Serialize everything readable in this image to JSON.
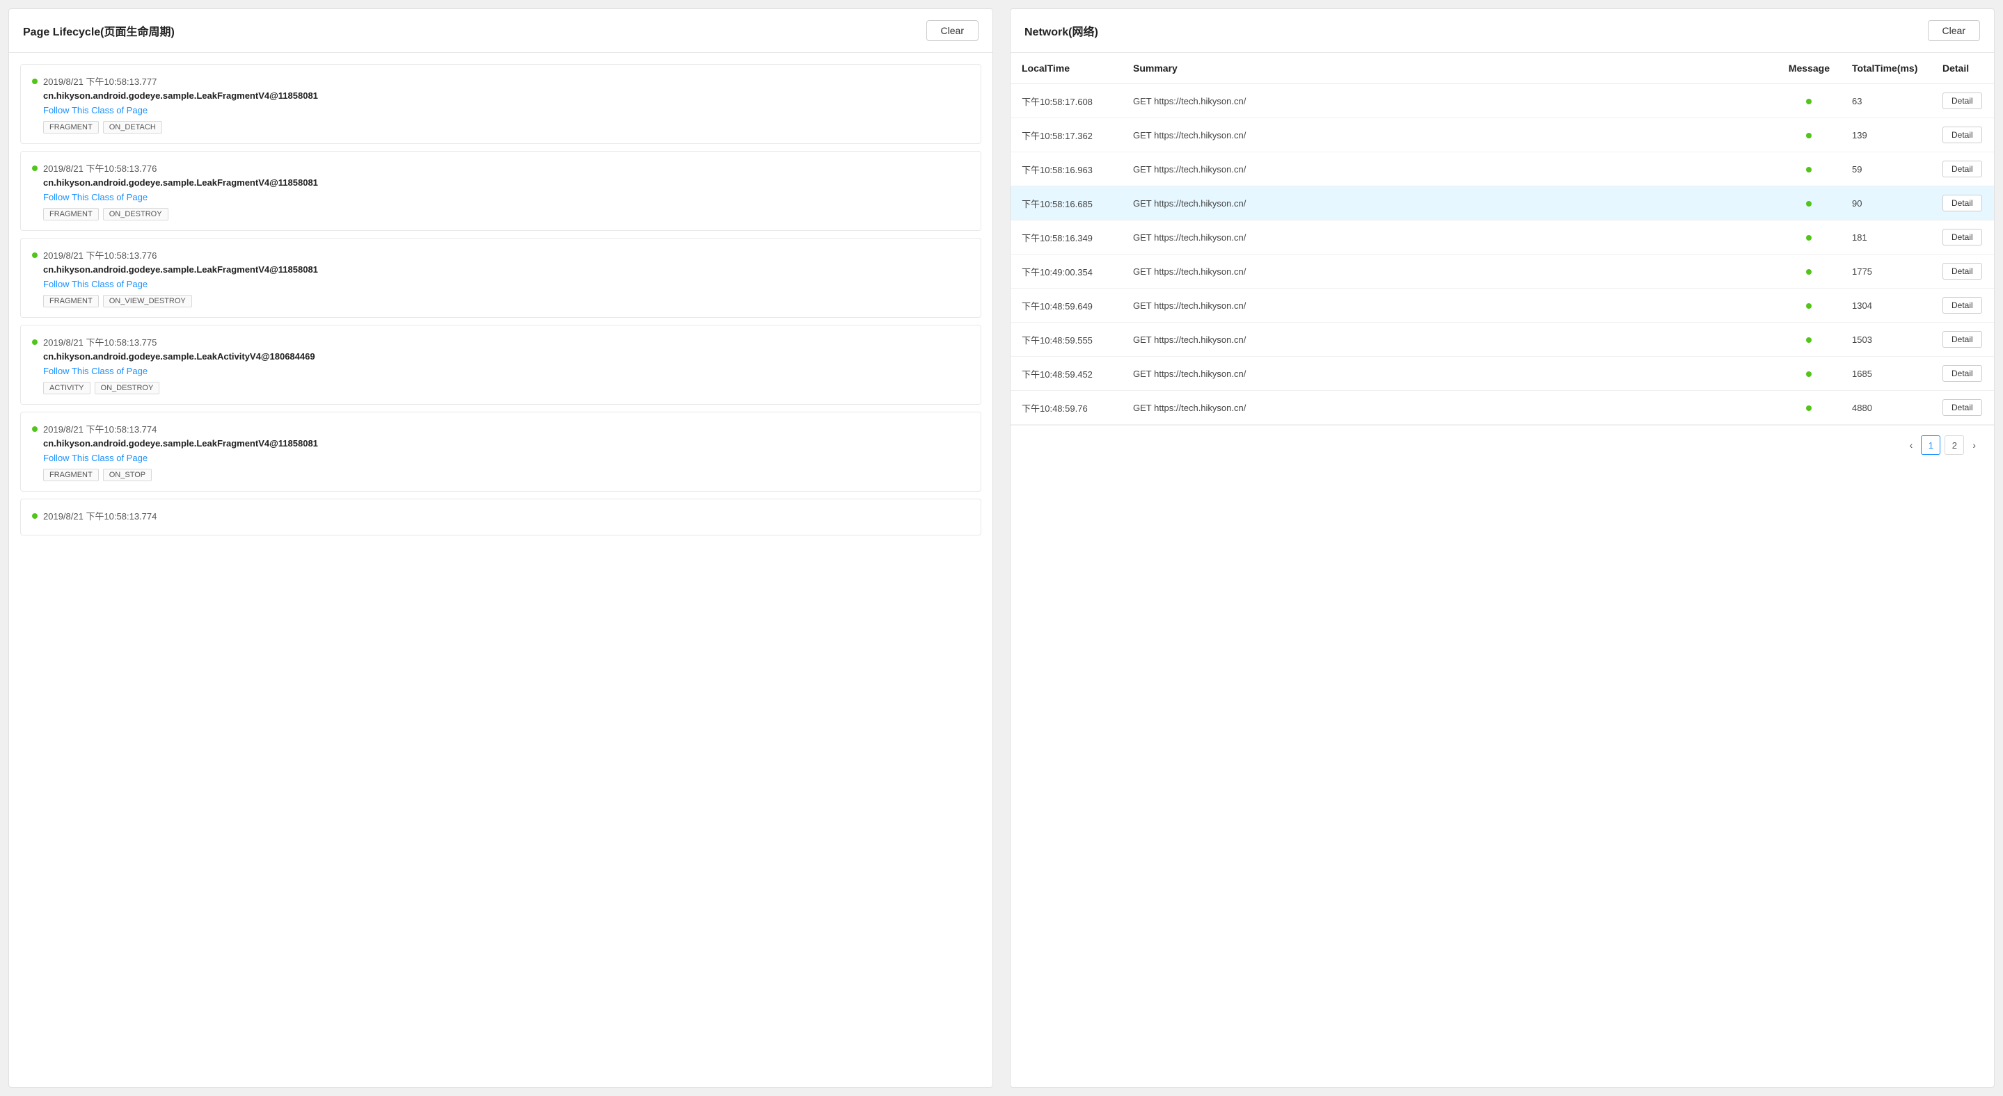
{
  "left_panel": {
    "title": "Page Lifecycle(页面生命周期)",
    "clear_label": "Clear",
    "items": [
      {
        "timestamp": "2019/8/21 下午10:58:13.777",
        "class_name": "cn.hikyson.android.godeye.sample.LeakFragmentV4",
        "instance": "@11858081",
        "follow_label": "Follow This Class of Page",
        "tags": [
          "FRAGMENT",
          "ON_DETACH"
        ],
        "dot_color": "green"
      },
      {
        "timestamp": "2019/8/21 下午10:58:13.776",
        "class_name": "cn.hikyson.android.godeye.sample.LeakFragmentV4",
        "instance": "@11858081",
        "follow_label": "Follow This Class of Page",
        "tags": [
          "FRAGMENT",
          "ON_DESTROY"
        ],
        "dot_color": "green"
      },
      {
        "timestamp": "2019/8/21 下午10:58:13.776",
        "class_name": "cn.hikyson.android.godeye.sample.LeakFragmentV4",
        "instance": "@11858081",
        "follow_label": "Follow This Class of Page",
        "tags": [
          "FRAGMENT",
          "ON_VIEW_DESTROY"
        ],
        "dot_color": "green"
      },
      {
        "timestamp": "2019/8/21 下午10:58:13.775",
        "class_name": "cn.hikyson.android.godeye.sample.LeakActivityV4",
        "instance": "@180684469",
        "follow_label": "Follow This Class of Page",
        "tags": [
          "ACTIVITY",
          "ON_DESTROY"
        ],
        "dot_color": "green"
      },
      {
        "timestamp": "2019/8/21 下午10:58:13.774",
        "class_name": "cn.hikyson.android.godeye.sample.LeakFragmentV4",
        "instance": "@11858081",
        "follow_label": "Follow This Class of Page",
        "tags": [
          "FRAGMENT",
          "ON_STOP"
        ],
        "dot_color": "green"
      },
      {
        "timestamp": "2019/8/21 下午10:58:13.774",
        "class_name": "",
        "instance": "",
        "follow_label": "",
        "tags": [],
        "dot_color": "green"
      }
    ]
  },
  "right_panel": {
    "title": "Network(网络)",
    "clear_label": "Clear",
    "columns": [
      "LocalTime",
      "Summary",
      "Message",
      "TotalTime(ms)",
      "Detail"
    ],
    "rows": [
      {
        "local_time": "下午10:58:17.608",
        "summary": "GET https://tech.hikyson.cn/",
        "message_status": "green",
        "total_time": "63",
        "detail_label": "Detail",
        "highlighted": false
      },
      {
        "local_time": "下午10:58:17.362",
        "summary": "GET https://tech.hikyson.cn/",
        "message_status": "green",
        "total_time": "139",
        "detail_label": "Detail",
        "highlighted": false
      },
      {
        "local_time": "下午10:58:16.963",
        "summary": "GET https://tech.hikyson.cn/",
        "message_status": "green",
        "total_time": "59",
        "detail_label": "Detail",
        "highlighted": false
      },
      {
        "local_time": "下午10:58:16.685",
        "summary": "GET https://tech.hikyson.cn/",
        "message_status": "green",
        "total_time": "90",
        "detail_label": "Detail",
        "highlighted": true
      },
      {
        "local_time": "下午10:58:16.349",
        "summary": "GET https://tech.hikyson.cn/",
        "message_status": "green",
        "total_time": "181",
        "detail_label": "Detail",
        "highlighted": false
      },
      {
        "local_time": "下午10:49:00.354",
        "summary": "GET https://tech.hikyson.cn/",
        "message_status": "green",
        "total_time": "1775",
        "detail_label": "Detail",
        "highlighted": false
      },
      {
        "local_time": "下午10:48:59.649",
        "summary": "GET https://tech.hikyson.cn/",
        "message_status": "green",
        "total_time": "1304",
        "detail_label": "Detail",
        "highlighted": false
      },
      {
        "local_time": "下午10:48:59.555",
        "summary": "GET https://tech.hikyson.cn/",
        "message_status": "green",
        "total_time": "1503",
        "detail_label": "Detail",
        "highlighted": false
      },
      {
        "local_time": "下午10:48:59.452",
        "summary": "GET https://tech.hikyson.cn/",
        "message_status": "green",
        "total_time": "1685",
        "detail_label": "Detail",
        "highlighted": false
      },
      {
        "local_time": "下午10:48:59.76",
        "summary": "GET https://tech.hikyson.cn/",
        "message_status": "green",
        "total_time": "4880",
        "detail_label": "Detail",
        "highlighted": false
      }
    ],
    "pagination": {
      "current": "1",
      "total": "2",
      "prev_label": "‹",
      "next_label": "›"
    }
  }
}
